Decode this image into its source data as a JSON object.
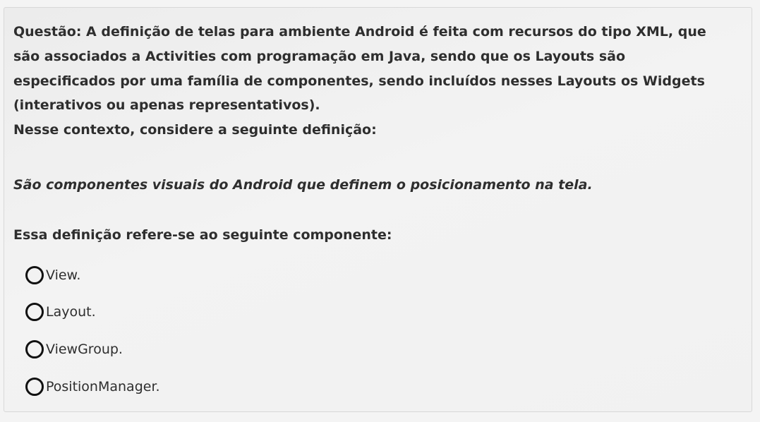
{
  "question": {
    "lines": [
      "Questão: A definição de telas para ambiente Android é feita com recursos do tipo XML, que",
      "são associados a Activities com programação em Java, sendo que os Layouts são",
      "especificados por uma família de componentes, sendo incluídos nesses Layouts os Widgets",
      "(interativos ou apenas representativos).",
      "Nesse contexto, considere a seguinte definição:"
    ],
    "definition": "São componentes visuais do Android que definem o posicionamento na tela.",
    "prompt": "Essa definição refere-se ao seguinte componente:"
  },
  "options": [
    {
      "label": "View.",
      "selected": false
    },
    {
      "label": "Layout.",
      "selected": false
    },
    {
      "label": "ViewGroup.",
      "selected": false
    },
    {
      "label": "PositionManager.",
      "selected": false
    }
  ],
  "colors": {
    "text": "#2e2e2e",
    "radio_border": "#111111",
    "card_border": "#d8d8d8"
  },
  "icons": {
    "option_radio": "radio-unchecked-icon"
  }
}
